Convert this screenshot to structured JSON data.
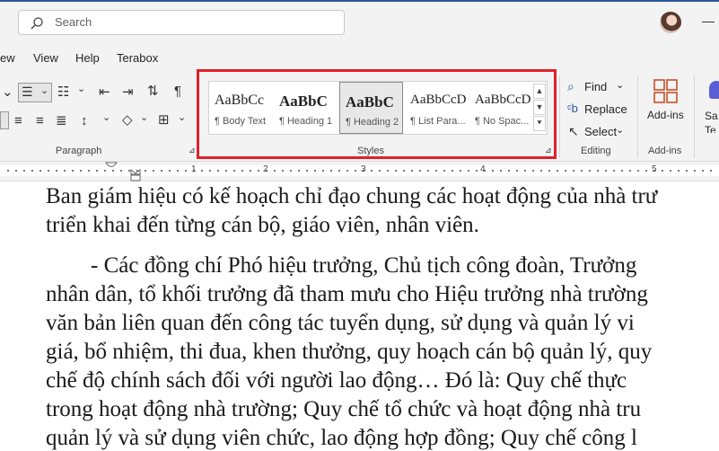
{
  "search": {
    "placeholder": "Search"
  },
  "menu": {
    "items": [
      "ew",
      "View",
      "Help",
      "Terabox"
    ]
  },
  "ribbon": {
    "paragraph_label": "Paragraph",
    "styles_label": "Styles",
    "editing_label": "Editing",
    "addins_label": "Add-ins",
    "styles": [
      {
        "sample": "AaBbCc",
        "name": "¶ Body Text"
      },
      {
        "sample": "AaBbC",
        "name": "¶ Heading 1"
      },
      {
        "sample": "AaBbC",
        "name": "¶ Heading 2"
      },
      {
        "sample": "AaBbCcD",
        "name": "¶ List Para..."
      },
      {
        "sample": "AaBbCcD",
        "name": "¶ No Spac..."
      }
    ],
    "editing": {
      "find": "Find",
      "replace": "Replace",
      "select": "Select"
    },
    "addins_button": "Add-ins",
    "save_partial": {
      "line1": "Sa",
      "line2": "Te"
    }
  },
  "ruler": {
    "numbers": [
      "1",
      "2",
      "3",
      "4",
      "5"
    ]
  },
  "document": {
    "lines": [
      "Ban giám hiệu có kế hoạch chỉ đạo chung các hoạt động của nhà trư",
      "triển khai đến từng cán bộ, giáo viên, nhân viên.",
      "        - Các đồng chí Phó hiệu trưởng, Chủ tịch công đoàn, Trưởng",
      "nhân dân, tổ khối trưởng đã tham mưu cho Hiệu trưởng nhà trường",
      "văn bản liên quan đến công tác tuyển dụng, sử dụng và quản lý vi",
      "giá, bổ nhiệm, thi đua, khen thưởng, quy hoạch cán bộ quản lý, quy",
      "chế độ chính sách đối với người lao động… Đó là: Quy chế thực",
      "trong hoạt động nhà trường; Quy chế tổ chức và hoạt động nhà tru",
      "quản lý và sử dụng viên chức, lao động hợp đồng; Quy chế công l"
    ]
  },
  "colors": {
    "highlight": "#e0202a",
    "accent": "#2b579a"
  }
}
